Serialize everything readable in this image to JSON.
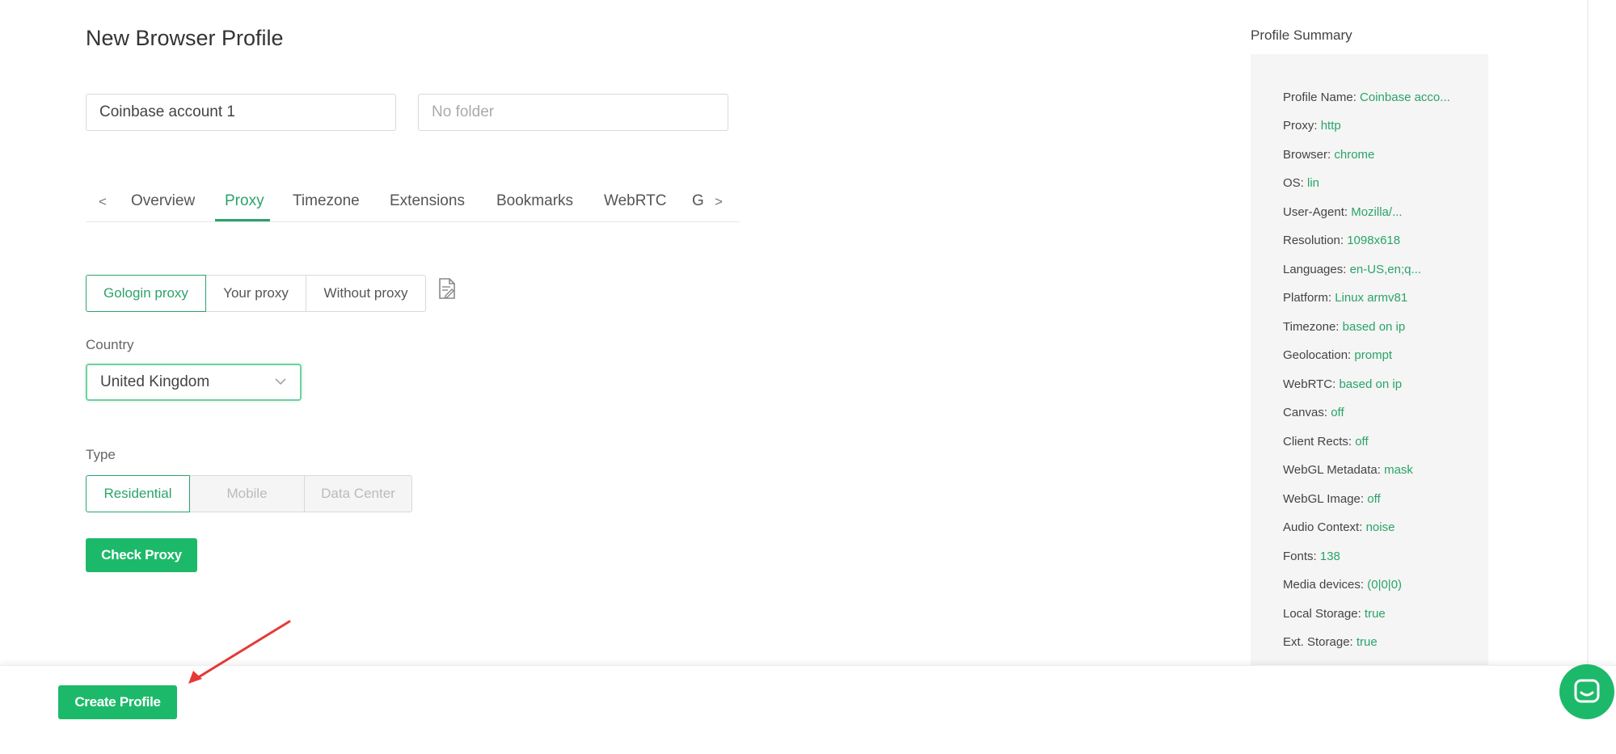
{
  "page": {
    "title": "New Browser Profile"
  },
  "profile": {
    "name_value": "Coinbase account 1",
    "folder_placeholder": "No folder"
  },
  "tabs": {
    "prev_glyph": "<",
    "next_glyph": ">",
    "items": [
      {
        "label": "Overview"
      },
      {
        "label": "Proxy",
        "active": true
      },
      {
        "label": "Timezone"
      },
      {
        "label": "Extensions"
      },
      {
        "label": "Bookmarks"
      },
      {
        "label": "WebRTC"
      },
      {
        "label": "G"
      }
    ]
  },
  "proxy": {
    "mode_options": [
      "Gologin proxy",
      "Your proxy",
      "Without proxy"
    ],
    "mode_selected": "Gologin proxy",
    "country_label": "Country",
    "country_value": "United Kingdom",
    "type_label": "Type",
    "type_options": [
      "Residential",
      "Mobile",
      "Data Center"
    ],
    "type_selected": "Residential",
    "check_button": "Check Proxy"
  },
  "summary": {
    "title": "Profile Summary",
    "rows": [
      {
        "key": "Profile Name:",
        "value": "Coinbase acco..."
      },
      {
        "key": "Proxy:",
        "value": "http"
      },
      {
        "key": "Browser:",
        "value": "chrome"
      },
      {
        "key": "OS:",
        "value": "lin"
      },
      {
        "key": "User-Agent:",
        "value": "Mozilla/..."
      },
      {
        "key": "Resolution:",
        "value": "1098x618"
      },
      {
        "key": "Languages:",
        "value": "en-US,en;q..."
      },
      {
        "key": "Platform:",
        "value": "Linux armv81"
      },
      {
        "key": "Timezone:",
        "value": "based on ip"
      },
      {
        "key": "Geolocation:",
        "value": "prompt"
      },
      {
        "key": "WebRTC:",
        "value": "based on ip"
      },
      {
        "key": "Canvas:",
        "value": "off"
      },
      {
        "key": "Client Rects:",
        "value": "off"
      },
      {
        "key": "WebGL Metadata:",
        "value": "mask"
      },
      {
        "key": "WebGL Image:",
        "value": "off"
      },
      {
        "key": "Audio Context:",
        "value": "noise"
      },
      {
        "key": "Fonts:",
        "value": "138"
      },
      {
        "key": "Media devices:",
        "value": "(0|0|0)"
      },
      {
        "key": "Local Storage:",
        "value": "true"
      },
      {
        "key": "Ext. Storage:",
        "value": "true"
      }
    ]
  },
  "footer": {
    "create_button": "Create Profile"
  },
  "colors": {
    "accent": "#1db96a",
    "accent_text": "#2ba36a",
    "arrow": "#e53935"
  },
  "icons": {
    "note": "note-edit-icon",
    "dropdown": "chevron-down-icon",
    "chat": "chat-icon"
  }
}
